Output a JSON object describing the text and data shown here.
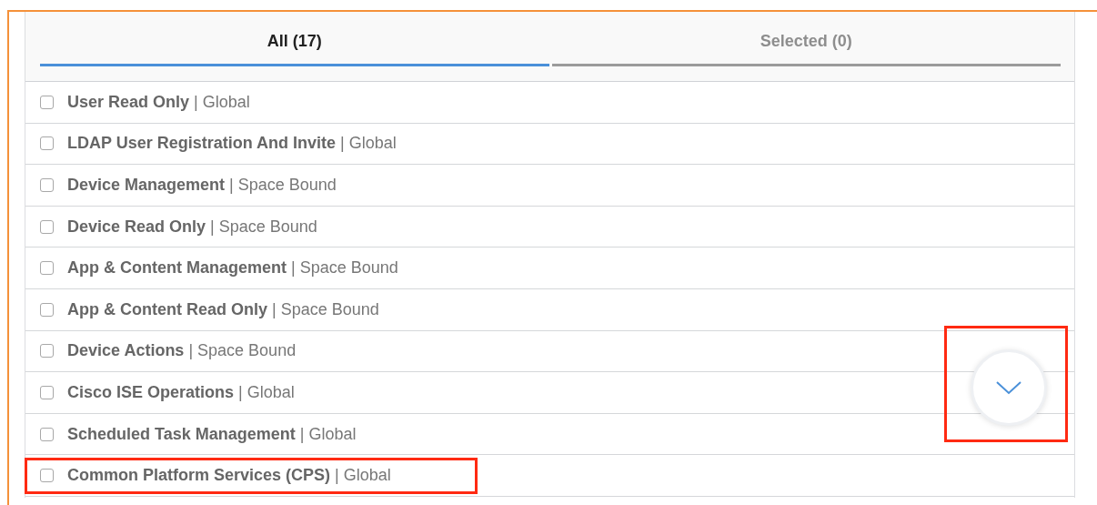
{
  "tabs": [
    {
      "label": "All (17)",
      "selected": true
    },
    {
      "label": "Selected (0)",
      "selected": false
    }
  ],
  "roles": [
    {
      "label": "**User Read Only** | Global",
      "checked": false,
      "highlighted": false
    },
    {
      "label": "**LDAP User Registration And Invite** | Global",
      "checked": false,
      "highlighted": false
    },
    {
      "label": "**Device Management** | Space Bound",
      "checked": false,
      "highlighted": false
    },
    {
      "label": "**Device Read Only** | Space Bound",
      "checked": false,
      "highlighted": false
    },
    {
      "label": "**App & Content Management** | Space Bound",
      "checked": false,
      "highlighted": false
    },
    {
      "label": "**App & Content Read Only** | Space Bound",
      "checked": false,
      "highlighted": false
    },
    {
      "label": "**Device Actions** | Space Bound",
      "checked": false,
      "highlighted": false
    },
    {
      "label": "**Cisco ISE Operations** | Global",
      "checked": false,
      "highlighted": false
    },
    {
      "label": "**Scheduled Task Management** | Global",
      "checked": false,
      "highlighted": false
    },
    {
      "label": "**Common Platform Services (CPS)** | Global",
      "checked": false,
      "highlighted": true
    }
  ],
  "scroll_button": {
    "highlighted": true
  }
}
